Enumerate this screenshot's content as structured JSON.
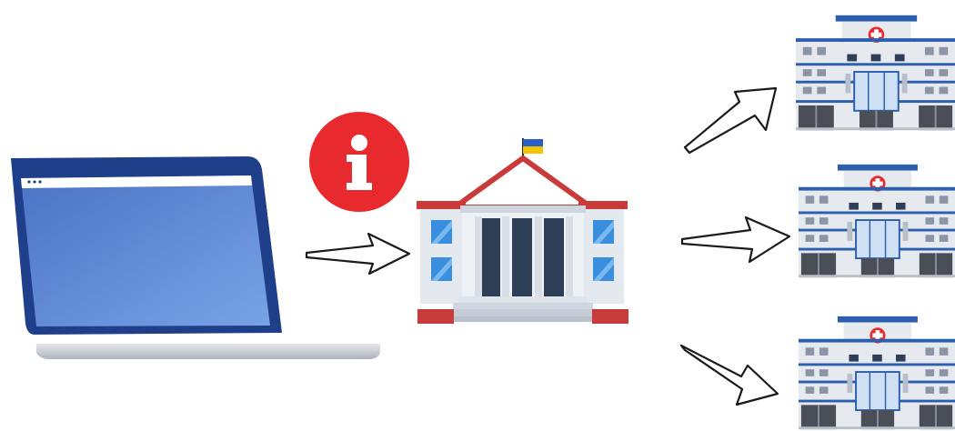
{
  "diagram": {
    "source": {
      "icon": "laptop-icon"
    },
    "info_badge": {
      "icon": "info-icon",
      "symbol": "i",
      "color": "#e8292e"
    },
    "hub": {
      "icon": "government-building-icon",
      "flag_colors": [
        "#2a5fc8",
        "#f5c400"
      ]
    },
    "targets": [
      {
        "icon": "hospital-icon"
      },
      {
        "icon": "hospital-icon"
      },
      {
        "icon": "hospital-icon"
      }
    ],
    "arrows": [
      {
        "icon": "arrow-right-icon",
        "from": "laptop",
        "to": "government-building"
      },
      {
        "icon": "arrow-up-right-icon",
        "from": "government-building",
        "to": "hospital-1"
      },
      {
        "icon": "arrow-right-icon",
        "from": "government-building",
        "to": "hospital-2"
      },
      {
        "icon": "arrow-down-right-icon",
        "from": "government-building",
        "to": "hospital-3"
      }
    ],
    "colors": {
      "laptop_frame": "#1f3f8a",
      "laptop_screen": "#5c88d6",
      "building_wall": "#e4e8ef",
      "roof_red": "#c93a3a",
      "hospital_blue": "#2b5fae",
      "window_dark": "#2e3e57",
      "door_gray": "#4a4f57",
      "cross_red": "#e8292e"
    }
  }
}
